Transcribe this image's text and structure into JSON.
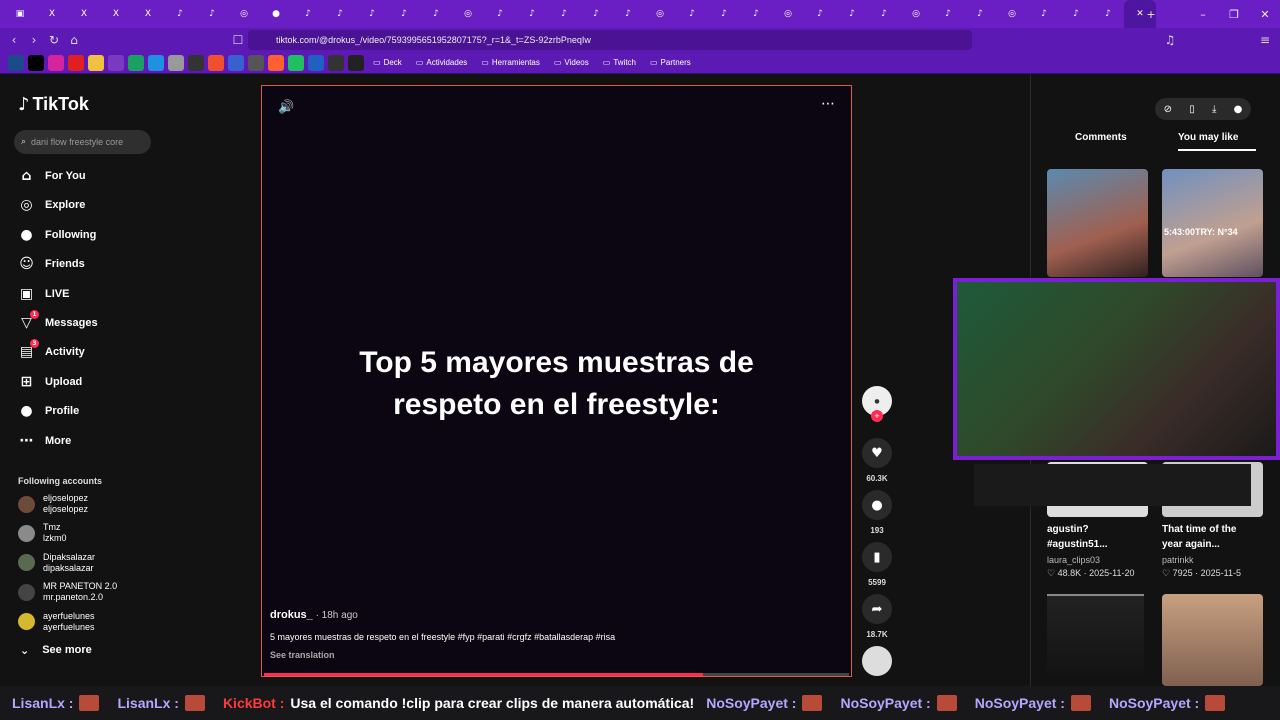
{
  "browser": {
    "url": "tiktok.com/@drokus_/video/7593995651952807175?_r=1&_t=ZS-92zrbPneqIw",
    "tabs": [
      "▣",
      "X",
      "X",
      "X",
      "X",
      "♪",
      "♪",
      "◎",
      "●",
      "♪",
      "♪",
      "♪",
      "♪",
      "♪",
      "◎",
      "♪",
      "♪",
      "♪",
      "♪",
      "♪",
      "◎",
      "♪",
      "♪",
      "♪",
      "◎",
      "♪",
      "♪",
      "♪",
      "◎",
      "♪",
      "♪",
      "◎",
      "♪",
      "♪",
      "♪"
    ],
    "active_tab_close": "✕",
    "new_tab": "+",
    "bookmarks": [
      "Deck",
      "Actividades",
      "Herramientas",
      "Videos",
      "Twitch",
      "Partners"
    ]
  },
  "sidebar": {
    "brand": "TikTok",
    "search_placeholder": "dani flow freestyle core",
    "nav": [
      {
        "label": "For You",
        "icon": "home-icon",
        "glyph": "⌂"
      },
      {
        "label": "Explore",
        "icon": "compass-icon",
        "glyph": "◎"
      },
      {
        "label": "Following",
        "icon": "following-avatar-icon",
        "glyph": "●"
      },
      {
        "label": "Friends",
        "icon": "friends-icon",
        "glyph": "☺"
      },
      {
        "label": "LIVE",
        "icon": "live-icon",
        "glyph": "▣"
      },
      {
        "label": "Messages",
        "icon": "messages-icon",
        "glyph": "▽",
        "badge": "1"
      },
      {
        "label": "Activity",
        "icon": "activity-icon",
        "glyph": "▤",
        "badge": "3"
      },
      {
        "label": "Upload",
        "icon": "upload-icon",
        "glyph": "⊞"
      },
      {
        "label": "Profile",
        "icon": "profile-avatar-icon",
        "glyph": "●"
      },
      {
        "label": "More",
        "icon": "more-icon",
        "glyph": "⋯"
      }
    ],
    "following_title": "Following accounts",
    "accounts": [
      {
        "name": "eljoselopez",
        "handle": "eljoselopez",
        "color": "#6d4b3a"
      },
      {
        "name": "Tmz",
        "handle": "lzkm0",
        "color": "#8a8a8a"
      },
      {
        "name": "Dipaksalazar",
        "handle": "dipaksalazar",
        "color": "#5a6a50"
      },
      {
        "name": "MR PANETON 2.0",
        "handle": "mr.paneton.2.0",
        "color": "#444"
      },
      {
        "name": "ayerfuelunes",
        "handle": "ayerfuelunes",
        "color": "#d4b830"
      }
    ],
    "see_more": "See more"
  },
  "video": {
    "caption": "Top 5 mayores muestras de respeto en el freestyle:",
    "author": "drokus_",
    "ago": " · 18h ago",
    "description": "5 mayores muestras de respeto en el freestyle #fyp #parati #crgfz #batallasderap #risa",
    "see_translation": "See translation",
    "progress": 0.75,
    "actions": {
      "likes": "60.3K",
      "comments": "193",
      "saves": "5599",
      "shares": "18.7K"
    }
  },
  "right": {
    "tabs": [
      "Comments",
      "You may like"
    ],
    "cards": [
      {
        "title": "agustin? #agustin51...",
        "user": "laura_clips03",
        "likes": "48.8K",
        "date": "2025-11-20"
      },
      {
        "title": "That time of the year again...",
        "user": "patrinkk",
        "likes": "7925",
        "date": "2025-11-5"
      }
    ],
    "thumb_top_text": "5:43:00TRY: N°34"
  },
  "chat": [
    {
      "user": "LisanLx :",
      "msg": ""
    },
    {
      "user": "LisanLx :",
      "msg": ""
    },
    {
      "user": "KickBot :",
      "msg": "Usa el comando !clip para crear clips de manera automática!"
    },
    {
      "user": "NoSoyPayet :",
      "msg": ""
    },
    {
      "user": "NoSoyPayet :",
      "msg": ""
    },
    {
      "user": "NoSoyPayet :",
      "msg": ""
    },
    {
      "user": "NoSoyPayet :",
      "msg": ""
    }
  ],
  "colors": {
    "accent": "#fe2c55",
    "browser": "#6a1fc4",
    "webcam_border": "#7a1fd4"
  }
}
